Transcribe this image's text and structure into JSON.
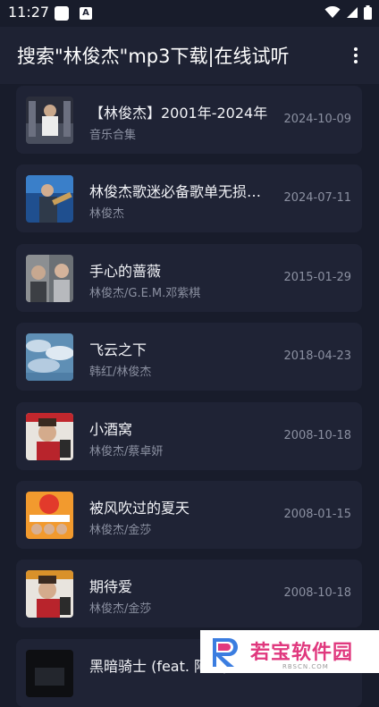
{
  "status_bar": {
    "time": "11:27",
    "icons": [
      "notification-square-icon",
      "a-badge-icon",
      "wifi-icon",
      "cellular-icon",
      "battery-icon"
    ]
  },
  "app_bar": {
    "title": "搜索\"林俊杰\"mp3下载|在线试听",
    "menu_icon": "more-vertical-icon"
  },
  "songs": [
    {
      "title": "【林俊杰】2001年-2024年",
      "subtitle": "音乐合集",
      "date": "2024-10-09"
    },
    {
      "title": "林俊杰歌迷必备歌单无损音质",
      "subtitle": "林俊杰",
      "date": "2024-07-11"
    },
    {
      "title": "手心的蔷薇",
      "subtitle": "林俊杰/G.E.M.邓紫棋",
      "date": "2015-01-29"
    },
    {
      "title": "飞云之下",
      "subtitle": "韩红/林俊杰",
      "date": "2018-04-23"
    },
    {
      "title": "小酒窝",
      "subtitle": "林俊杰/蔡卓妍",
      "date": "2008-10-18"
    },
    {
      "title": "被风吹过的夏天",
      "subtitle": "林俊杰/金莎",
      "date": "2008-01-15"
    },
    {
      "title": "期待爱",
      "subtitle": "林俊杰/金莎",
      "date": "2008-10-18"
    },
    {
      "title": "黑暗骑士 (feat. 阿牛)",
      "subtitle": "",
      "date": ""
    }
  ],
  "watermark": {
    "text": "若宝软件园",
    "sub": "RBSCN.COM"
  },
  "colors": {
    "background": "#181c2b",
    "card": "#1f2335",
    "app_bar": "#1e2233",
    "secondary_text": "#8b90a1",
    "watermark_accent": "#e0387e"
  }
}
